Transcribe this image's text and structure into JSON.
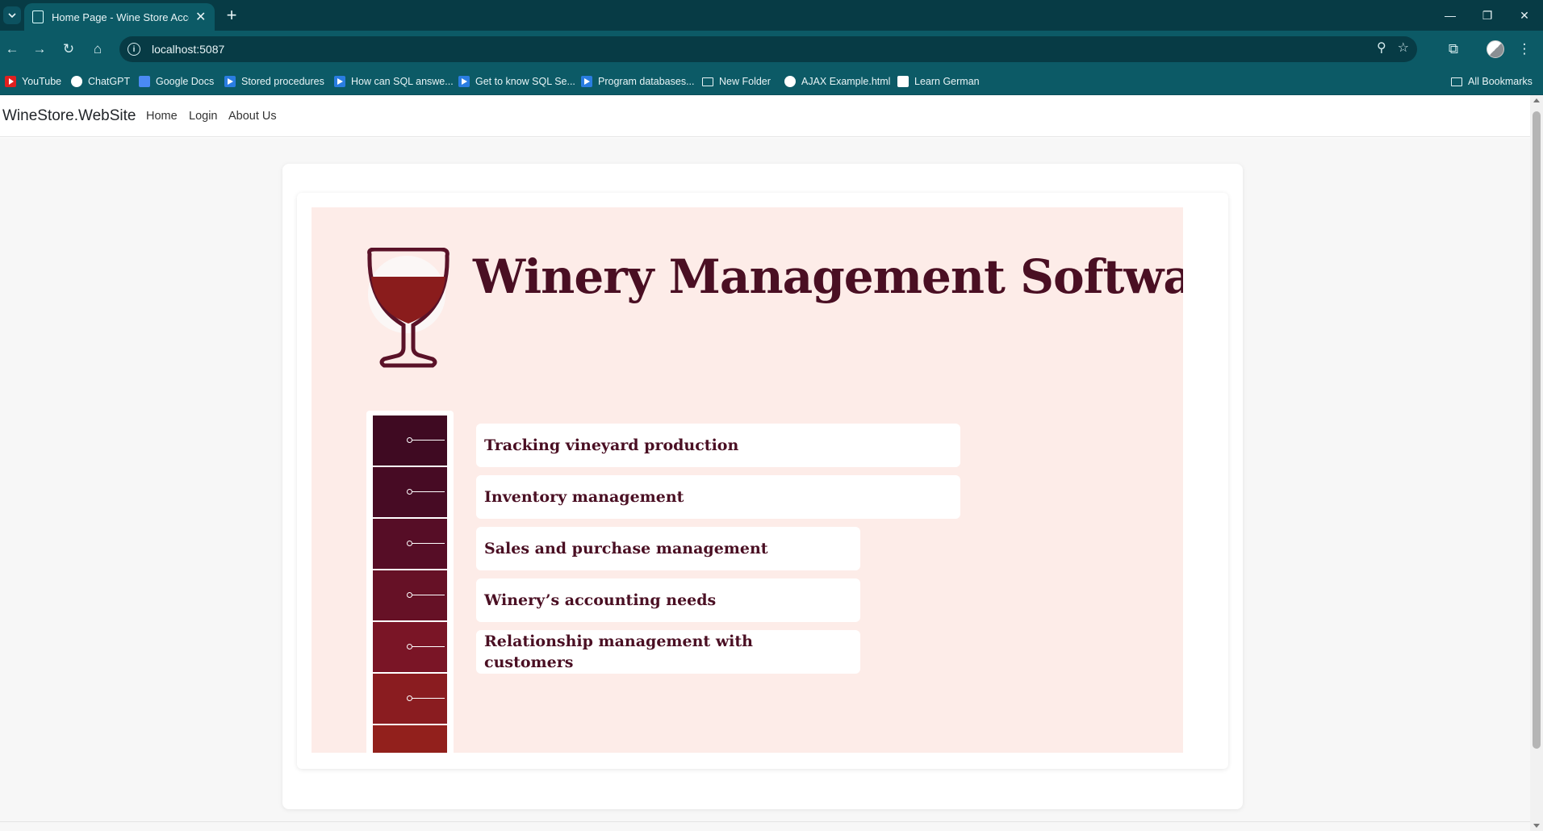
{
  "browser": {
    "tab_title": "Home Page - Wine Store Accou",
    "url": "localhost:5087",
    "bookmarks": [
      {
        "label": "YouTube",
        "icon": "youtube-icon"
      },
      {
        "label": "ChatGPT",
        "icon": "chatgpt-icon"
      },
      {
        "label": "Google Docs",
        "icon": "google-docs-icon"
      },
      {
        "label": "Stored procedures",
        "icon": "video-icon"
      },
      {
        "label": "How can SQL answe...",
        "icon": "video-icon"
      },
      {
        "label": "Get to know SQL Se...",
        "icon": "video-icon"
      },
      {
        "label": "Program databases...",
        "icon": "video-icon"
      },
      {
        "label": "New Folder",
        "icon": "folder-icon"
      },
      {
        "label": "AJAX Example.html",
        "icon": "globe-icon"
      },
      {
        "label": "Learn German",
        "icon": "learn-german-icon"
      }
    ],
    "all_bookmarks": "All Bookmarks"
  },
  "site": {
    "brand": "WineStore.WebSite",
    "nav": [
      {
        "label": "Home"
      },
      {
        "label": "Login"
      },
      {
        "label": "About Us"
      }
    ]
  },
  "banner": {
    "title": "Winery Management Software",
    "features": [
      {
        "line1": "Tracking vineyard production",
        "line2": ""
      },
      {
        "line1": "Inventory management",
        "line2": ""
      },
      {
        "line1": "Sales and purchase management",
        "line2": ""
      },
      {
        "line1": "Winery’s accounting needs",
        "line2": ""
      },
      {
        "line1": "Relationship management with",
        "line2": "customers"
      }
    ],
    "colors": {
      "background": "#fdece8",
      "title": "#4a0f23",
      "block_shades": [
        "#3f0a22",
        "#470b24",
        "#560d26",
        "#661126",
        "#7a1526",
        "#8a1c20",
        "#92201c"
      ]
    }
  }
}
